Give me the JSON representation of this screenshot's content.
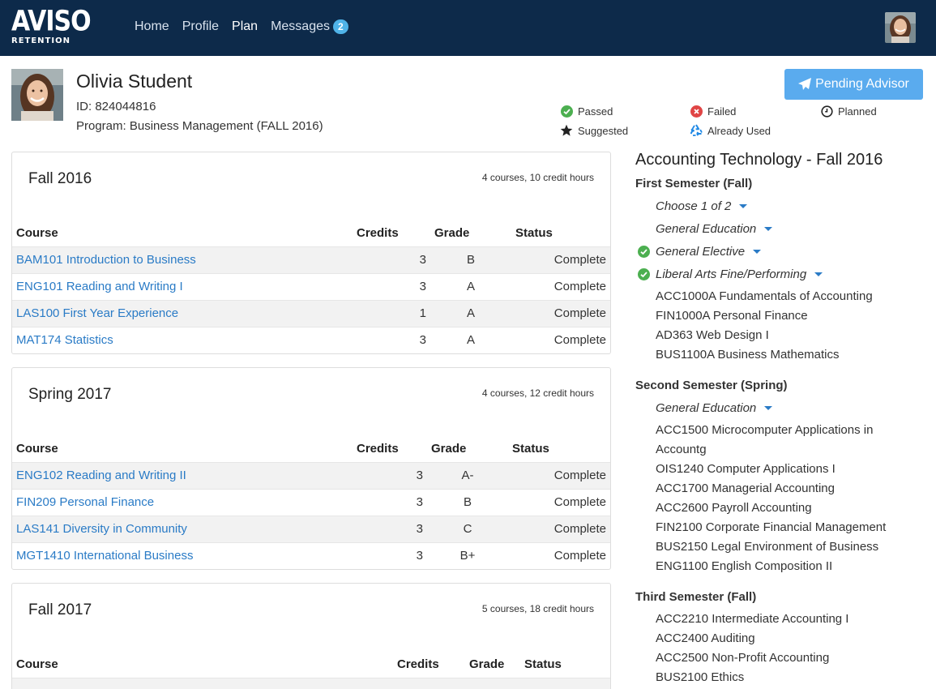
{
  "nav": {
    "logo_top": "AVISO",
    "logo_bottom": "RETENTION",
    "items": [
      "Home",
      "Profile",
      "Plan",
      "Messages"
    ],
    "messages_count": "2",
    "active": "Plan"
  },
  "student": {
    "name": "Olivia Student",
    "id": "ID: 824044816",
    "program": "Program: Business Management (FALL 2016)"
  },
  "pending_button": "Pending Advisor",
  "legend": {
    "passed": "Passed",
    "failed": "Failed",
    "planned": "Planned",
    "suggested": "Suggested",
    "already_used": "Already Used"
  },
  "table_headers": {
    "course": "Course",
    "credits": "Credits",
    "grade": "Grade",
    "status": "Status"
  },
  "terms": [
    {
      "title": "Fall 2016",
      "summary": "4 courses, 10 credit hours",
      "rows": [
        {
          "course": "BAM101 Introduction to Business",
          "credits": "3",
          "grade": "B",
          "status": "Complete"
        },
        {
          "course": "ENG101 Reading and Writing I",
          "credits": "3",
          "grade": "A",
          "status": "Complete"
        },
        {
          "course": "LAS100 First Year Experience",
          "credits": "1",
          "grade": "A",
          "status": "Complete"
        },
        {
          "course": "MAT174 Statistics",
          "credits": "3",
          "grade": "A",
          "status": "Complete"
        }
      ]
    },
    {
      "title": "Spring 2017",
      "summary": "4 courses, 12 credit hours",
      "rows": [
        {
          "course": "ENG102 Reading and Writing II",
          "credits": "3",
          "grade": "A-",
          "status": "Complete"
        },
        {
          "course": "FIN209 Personal Finance",
          "credits": "3",
          "grade": "B",
          "status": "Complete"
        },
        {
          "course": "LAS141 Diversity in Community",
          "credits": "3",
          "grade": "C",
          "status": "Complete"
        },
        {
          "course": "MGT1410 International Business",
          "credits": "3",
          "grade": "B+",
          "status": "Complete"
        }
      ]
    },
    {
      "title": "Fall 2017",
      "summary": "5 courses, 18 credit hours",
      "rows": []
    }
  ],
  "program_plan": {
    "title": "Accounting Technology - Fall 2016",
    "semesters": [
      {
        "title": "First Semester (Fall)",
        "requirements": [
          {
            "label": "Choose 1 of 2",
            "passed": false
          },
          {
            "label": "General Education",
            "passed": false
          },
          {
            "label": "General Elective",
            "passed": true
          },
          {
            "label": "Liberal Arts Fine/Performing",
            "passed": true
          }
        ],
        "courses": [
          "ACC1000A Fundamentals of Accounting",
          "FIN1000A Personal Finance",
          "AD363 Web Design I",
          "BUS1100A Business Mathematics"
        ]
      },
      {
        "title": "Second Semester (Spring)",
        "requirements": [
          {
            "label": "General Education",
            "passed": false
          }
        ],
        "courses": [
          "ACC1500 Microcomputer Applications in Accountg",
          "OIS1240 Computer Applications I",
          "ACC1700 Managerial Accounting",
          "ACC2600 Payroll Accounting",
          "FIN2100 Corporate Financial Management",
          "BUS2150 Legal Environment of Business",
          "ENG1100 English Composition II"
        ]
      },
      {
        "title": "Third Semester (Fall)",
        "requirements": [],
        "courses": [
          "ACC2210 Intermediate Accounting I",
          "ACC2400 Auditing",
          "ACC2500 Non-Profit Accounting",
          "BUS2100 Ethics"
        ]
      }
    ]
  },
  "colors": {
    "navbar": "#0d2a4a",
    "link": "#2a7bc6",
    "button": "#5aabee",
    "passed": "#4caf50",
    "failed": "#e04545",
    "recycle": "#1e88e5"
  }
}
